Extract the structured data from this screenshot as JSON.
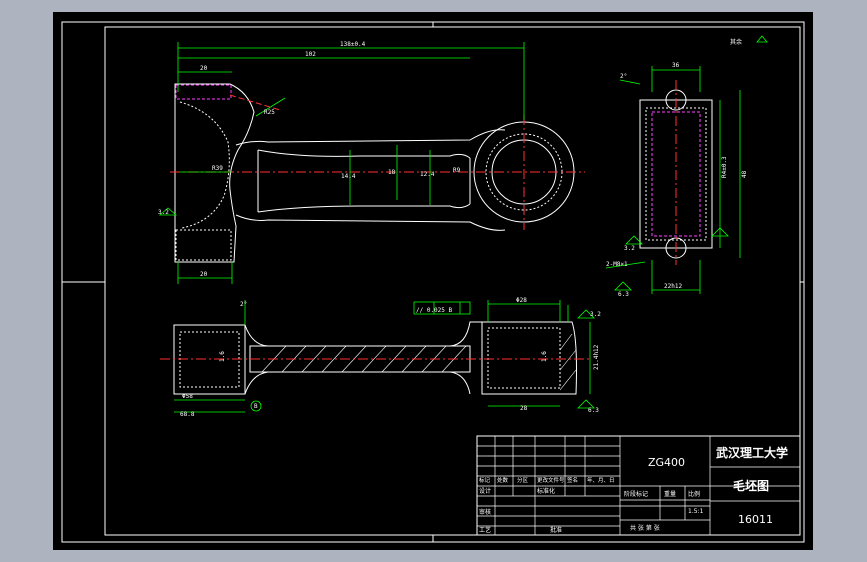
{
  "title_block": {
    "material": "ZG400",
    "school": "武汉理工大学",
    "drawing_name": "毛坯图",
    "drawing_no": "16011",
    "scale": "1.5:1",
    "row_headers": [
      "标记",
      "处数",
      "分区",
      "更改文件号",
      "签名",
      "年、月、日"
    ],
    "design_label": "设计",
    "standard_label": "标准化",
    "review_label": "审核",
    "process_label": "工艺",
    "approve_label": "批准",
    "stage_label": "阶段标记",
    "weight_label": "重量",
    "scale_label": "比例",
    "sheet_info": "共 张 第 张"
  },
  "roughness_note": "其余",
  "dimensions": {
    "overall_length": "138±0.4",
    "center_distance": "102",
    "small_end_width_top": "20",
    "small_end_width_bottom": "20",
    "r25": "R25",
    "r39": "R39",
    "rough_left": "3.2",
    "shank_a": "14.4",
    "shank_b": "18",
    "shank_c": "12.4",
    "r9": "R9",
    "side_top_width": "36",
    "side_height_a": "R4±0.3",
    "side_height_b": "48",
    "side_bottom": "22h12",
    "rough_right_1": "3.2",
    "rough_right_2": "2-M8×1",
    "rough_right_3": "6.3",
    "taper_top": "2°",
    "tol_frame": "//  0.025  B",
    "sec_top": "Φ28",
    "sec_right": "21.4h12",
    "sec_left_1": "1.6",
    "sec_left_2": "Φ58",
    "sec_left_3": "68.8",
    "sec_right_1": "3.2",
    "sec_right_2": "1.6",
    "sec_bottom": "28",
    "sec_rough": "6.3",
    "datum": "B",
    "taper_sec": "2°"
  }
}
